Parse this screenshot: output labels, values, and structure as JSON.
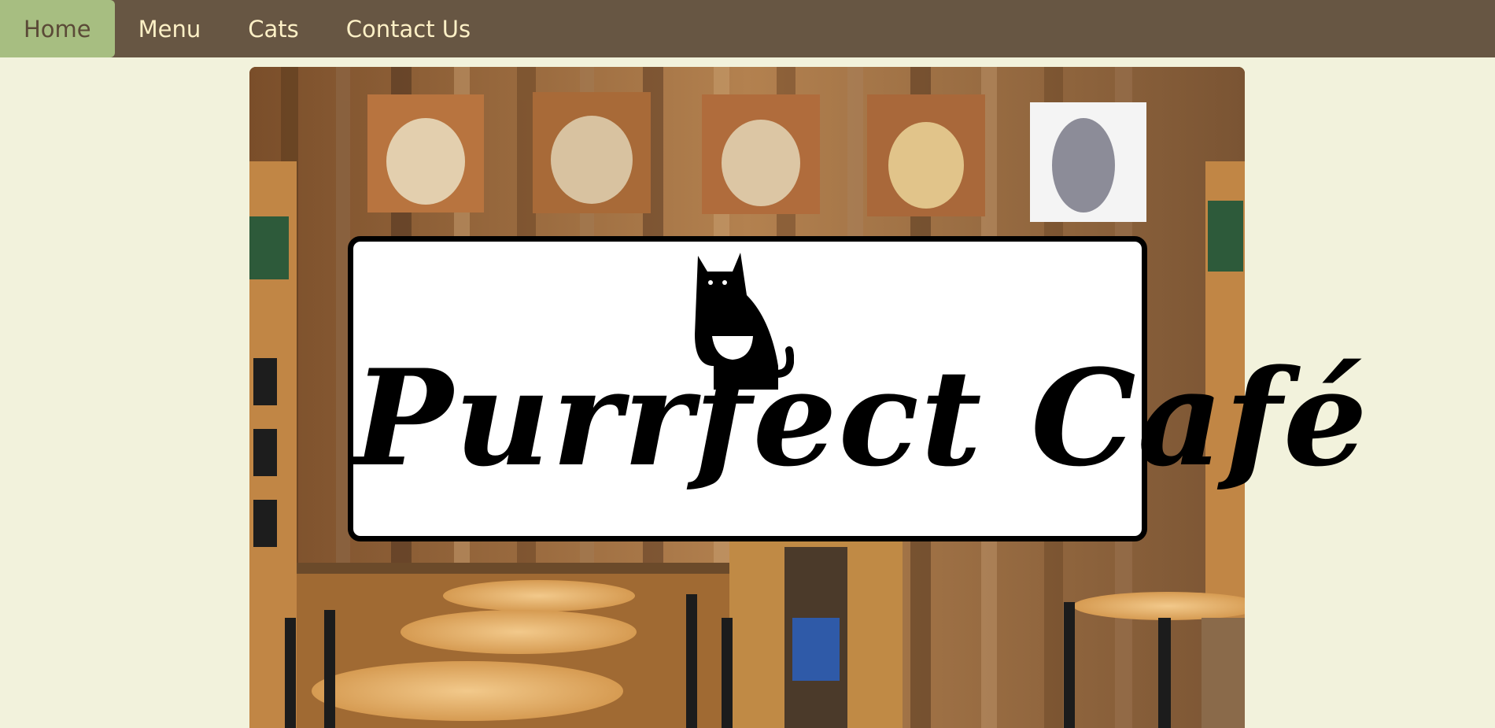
{
  "nav": {
    "items": [
      {
        "label": "Home",
        "active": true
      },
      {
        "label": "Menu",
        "active": false
      },
      {
        "label": "Cats",
        "active": false
      },
      {
        "label": "Contact Us",
        "active": false
      }
    ]
  },
  "hero": {
    "logo_text": "Purrfect Café"
  },
  "colors": {
    "page_bg": "#f2f2dc",
    "nav_bg": "#675643",
    "nav_active_bg": "#a7be81",
    "nav_text": "#fdf0c6",
    "nav_active_text": "#5b4a37"
  }
}
